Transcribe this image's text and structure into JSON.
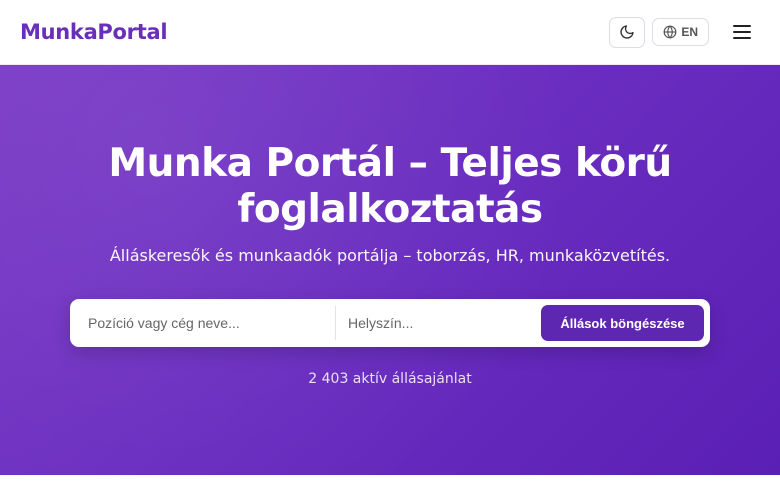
{
  "header": {
    "logo": "MunkaPortal",
    "lang_label": "EN",
    "icons": {
      "theme": "moon-icon",
      "lang": "globe-icon",
      "menu": "hamburger-menu-icon"
    }
  },
  "hero": {
    "title": "Munka Portál – Teljes körű foglalkoztatás",
    "subtitle": "Álláskeresők és munkaadók portálja – toborzás, HR, munkaközvetítés.",
    "job_count": "2 403 aktív állásajánlat"
  },
  "search": {
    "position_placeholder": "Pozíció vagy cég neve...",
    "position_value": "",
    "location_placeholder": "Helyszín...",
    "location_value": "",
    "button_label": "Állások böngészése"
  },
  "colors": {
    "brand": "#6a2fb8",
    "hero_start": "#7a3bc6",
    "hero_end": "#5a1fb4",
    "button": "#5e27b2"
  }
}
